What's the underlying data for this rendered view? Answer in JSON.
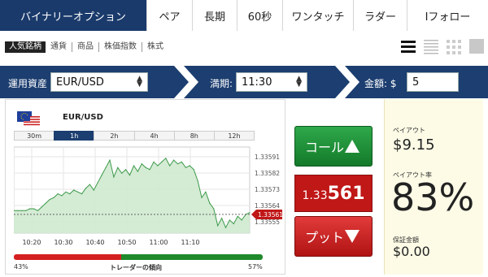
{
  "tabs": [
    {
      "label": "バイナリーオプション",
      "active": true
    },
    {
      "label": "ペア",
      "active": false
    },
    {
      "label": "長期",
      "active": false
    },
    {
      "label": "60秒",
      "active": false
    },
    {
      "label": "ワンタッチ",
      "active": false
    },
    {
      "label": "ラダー",
      "active": false
    },
    {
      "label": "Iフォロー",
      "active": false
    }
  ],
  "subnav": [
    {
      "label": "人気銘柄",
      "active": true
    },
    {
      "label": "通貨",
      "active": false
    },
    {
      "label": "商品",
      "active": false
    },
    {
      "label": "株価指数",
      "active": false
    },
    {
      "label": "株式",
      "active": false
    }
  ],
  "controls": {
    "asset_label": "運用資産",
    "asset_value": "EUR/USD",
    "expiry_label": "満期:",
    "expiry_value": "11:30",
    "amount_label": "金額: $",
    "amount_value": "5"
  },
  "chart_panel": {
    "pair": "EUR/USD",
    "timeframes": [
      {
        "label": "30m",
        "active": false
      },
      {
        "label": "1h",
        "active": true
      },
      {
        "label": "2h",
        "active": false
      },
      {
        "label": "4h",
        "active": false
      },
      {
        "label": "8h",
        "active": false
      },
      {
        "label": "12h",
        "active": false
      }
    ],
    "sentiment": {
      "put_pct_label": "43%",
      "call_pct_label": "57%",
      "put_fraction": 0.43,
      "label": "トレーダーの傾向"
    }
  },
  "chart_data": {
    "type": "area",
    "x_ticks": [
      "10:20",
      "10:30",
      "10:40",
      "10:50",
      "11:00",
      "11:10"
    ],
    "y_ticks": [
      "1.33591",
      "1.33582",
      "1.33573",
      "1.33564",
      "1.33555"
    ],
    "ylim": [
      1.33551,
      1.33597
    ],
    "strike_value": 1.33561,
    "current_label": "1.33561",
    "series": [
      {
        "values": [
          1.33563,
          1.33563,
          1.33563,
          1.33563,
          1.33564,
          1.33564,
          1.33563,
          1.33565,
          1.33567,
          1.33569,
          1.3357,
          1.33572,
          1.33571,
          1.33573,
          1.33572,
          1.33574,
          1.33573,
          1.33572,
          1.33575,
          1.33577,
          1.33574,
          1.33578,
          1.33582,
          1.33586,
          1.3359,
          1.33581,
          1.33586,
          1.33583,
          1.33585,
          1.33582,
          1.33587,
          1.33584,
          1.33588,
          1.33586,
          1.33585,
          1.33589,
          1.33587,
          1.33589,
          1.33591,
          1.33587,
          1.3359,
          1.33588,
          1.33589,
          1.33586,
          1.33587,
          1.33585,
          1.33579,
          1.3357,
          1.33573,
          1.33567,
          1.33564,
          1.33555,
          1.33559,
          1.33554,
          1.33558,
          1.33556,
          1.3356,
          1.33558,
          1.33561,
          1.33562
        ]
      }
    ]
  },
  "buttons": {
    "call_label": "コール",
    "put_label": "プット"
  },
  "price": {
    "prefix": "1.33",
    "suffix": "561"
  },
  "payout": {
    "payout_label": "ペイアウト",
    "payout_value": "$9.15",
    "rate_label": "ペイアウト率",
    "rate_value": "83%",
    "deposit_label": "保証金額",
    "deposit_value": "$0.00"
  },
  "colors": {
    "navy": "#1c3e70",
    "call_green": "#1f8a2c",
    "put_red": "#c01717",
    "chart_line": "#3c9a4a",
    "chart_fill": "#cfe9cf"
  }
}
